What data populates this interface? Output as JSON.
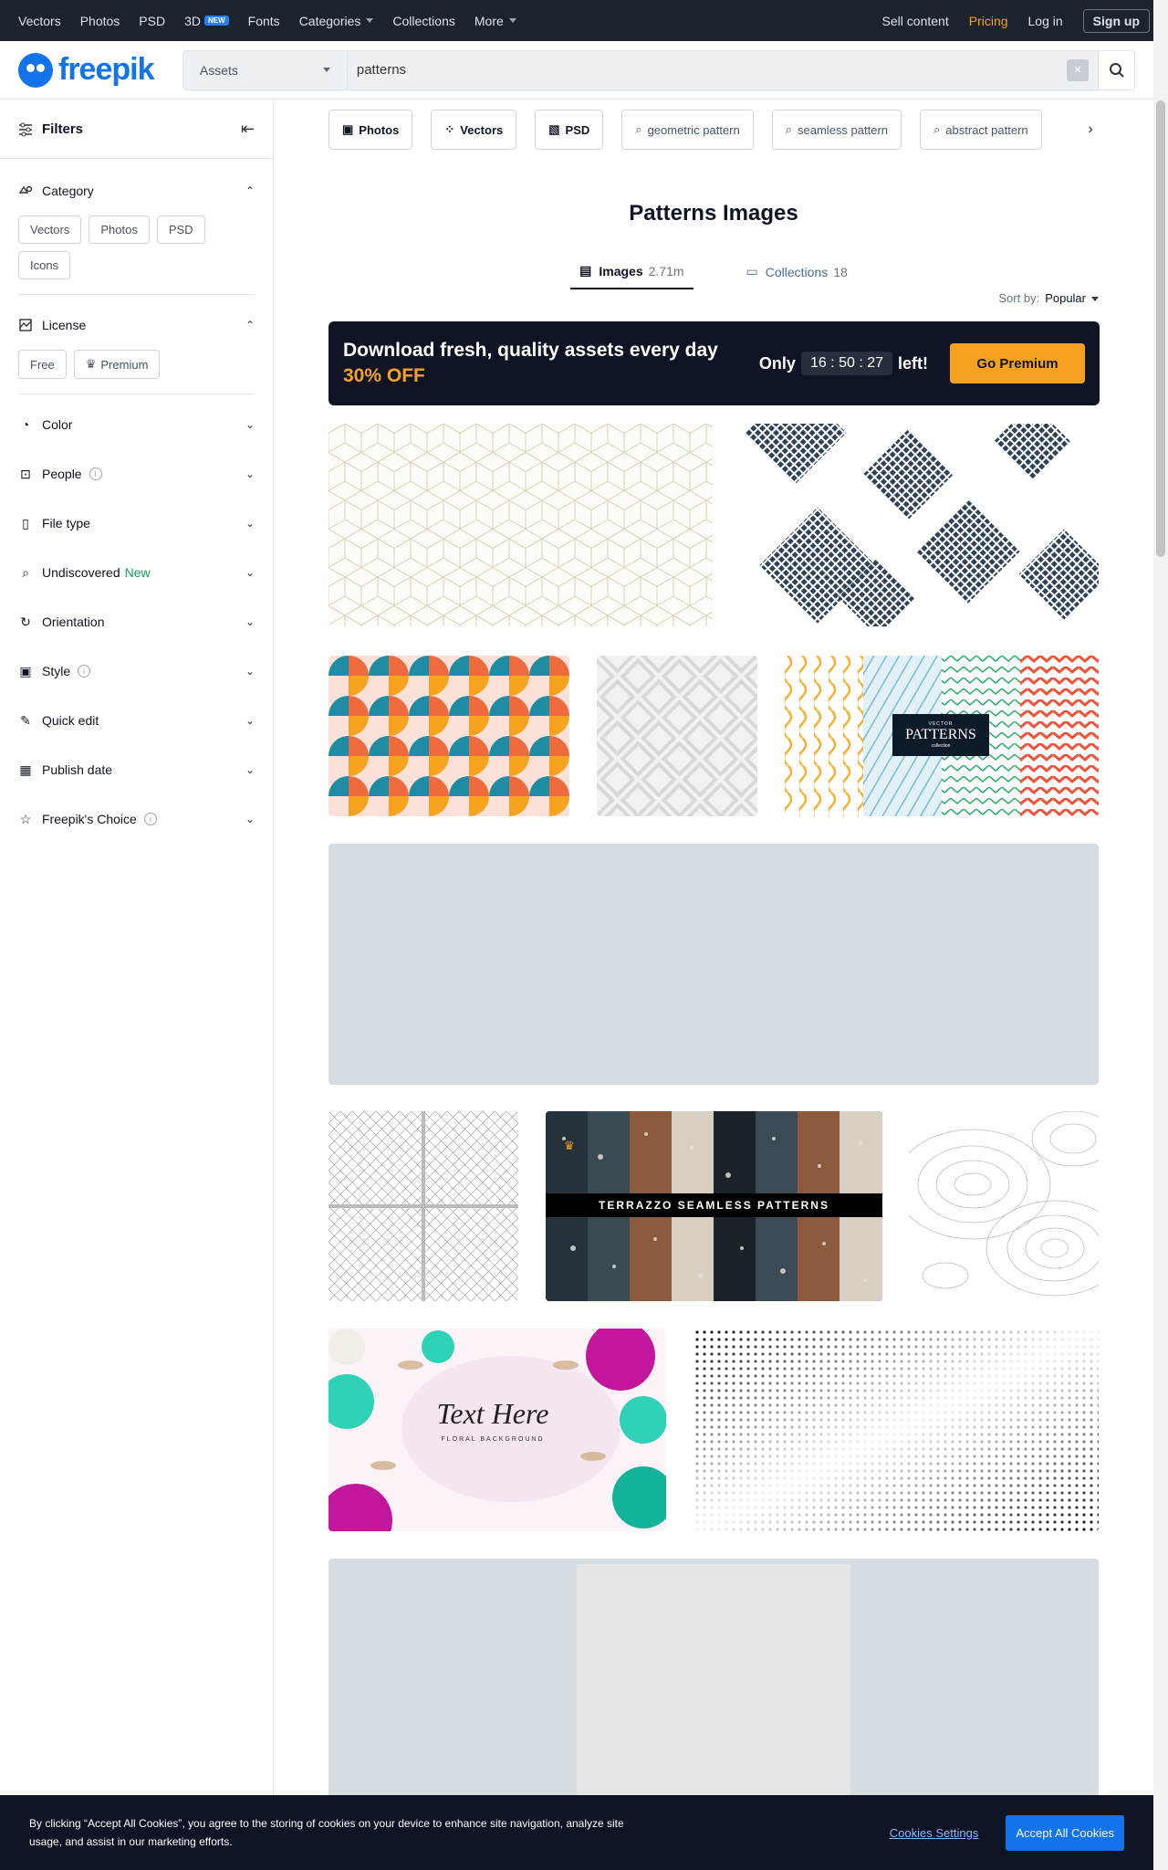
{
  "topnav": {
    "items": [
      "Vectors",
      "Photos",
      "PSD",
      "3D",
      "Fonts",
      "Categories",
      "Collections",
      "More"
    ],
    "badge_3d": "NEW",
    "right": {
      "sell": "Sell content",
      "pricing": "Pricing",
      "login": "Log in",
      "signup": "Sign up"
    }
  },
  "logo": "freepik",
  "search": {
    "scope": "Assets",
    "query": "patterns",
    "clear": "×"
  },
  "sidebar": {
    "title": "Filters",
    "category": {
      "label": "Category",
      "chips": [
        "Vectors",
        "Photos",
        "PSD",
        "Icons"
      ]
    },
    "license": {
      "label": "License",
      "chips": [
        "Free",
        "Premium"
      ]
    },
    "sections": [
      {
        "label": "Color",
        "icon": "palette-icon"
      },
      {
        "label": "People",
        "icon": "people-icon",
        "info": true
      },
      {
        "label": "File type",
        "icon": "file-icon"
      },
      {
        "label": "Undiscovered",
        "icon": "search-sparkle-icon",
        "tag": "New"
      },
      {
        "label": "Orientation",
        "icon": "rotate-icon"
      },
      {
        "label": "Style",
        "icon": "image-icon",
        "info": true
      },
      {
        "label": "Quick edit",
        "icon": "brush-icon"
      },
      {
        "label": "Publish date",
        "icon": "calendar-icon"
      },
      {
        "label": "Freepik's Choice",
        "icon": "star-icon",
        "info": true
      }
    ]
  },
  "related": [
    "Photos",
    "Vectors",
    "PSD",
    "geometric pattern",
    "seamless pattern",
    "abstract pattern"
  ],
  "page_title": "Patterns Images",
  "tabs": {
    "images": "Images",
    "images_count": "2.71m",
    "collections": "Collections",
    "collections_count": "18"
  },
  "sort": {
    "label": "Sort by:",
    "value": "Popular"
  },
  "promo": {
    "line1": "Download fresh, quality assets every day",
    "line2": "30% OFF",
    "only": "Only",
    "timer": "16 : 50 : 27",
    "left": "left!",
    "cta": "Go Premium"
  },
  "tiles": {
    "terrazzo": "TERRAZZO SEAMLESS PATTERNS",
    "patterns_word": "PATTERNS",
    "patterns_top": "VECTOR",
    "patterns_bottom": "collection",
    "floral_script": "Text Here",
    "floral_sub": "FLORAL BACKGROUND"
  },
  "cookies": {
    "message": "By clicking “Accept All Cookies”, you agree to the storing of cookies on your device to enhance site navigation, analyze site usage, and assist in our marketing efforts.",
    "settings": "Cookies Settings",
    "accept": "Accept All Cookies"
  }
}
